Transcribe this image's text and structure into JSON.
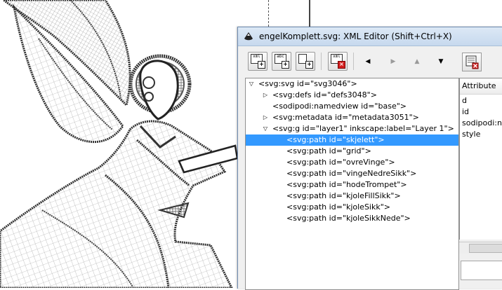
{
  "window": {
    "title": "engelKomplett.svg: XML Editor (Shift+Ctrl+X)"
  },
  "toolbar": {
    "new_element_glyph": "xml",
    "new_text_glyph": "abc",
    "delete_glyph": "xml",
    "nav_left": "◀",
    "nav_right": "▶",
    "nav_up": "▲",
    "nav_down": "▼"
  },
  "tree": {
    "rows": [
      {
        "expander": "▽",
        "text": "<svg:svg id=\"svg3046\">"
      },
      {
        "expander": "▷",
        "text": "<svg:defs id=\"defs3048\">"
      },
      {
        "expander": "",
        "text": "<sodipodi:namedview id=\"base\">"
      },
      {
        "expander": "▷",
        "text": "<svg:metadata id=\"metadata3051\">"
      },
      {
        "expander": "▽",
        "text": "<svg:g id=\"layer1\" inkscape:label=\"Layer 1\">"
      },
      {
        "expander": "",
        "text": "<svg:path id=\"skjelett\">"
      },
      {
        "expander": "",
        "text": "<svg:path id=\"grid\">"
      },
      {
        "expander": "",
        "text": "<svg:path id=\"ovreVinge\">"
      },
      {
        "expander": "",
        "text": "<svg:path id=\"vingeNedreSikk\">"
      },
      {
        "expander": "",
        "text": "<svg:path id=\"hodeTrompet\">"
      },
      {
        "expander": "",
        "text": "<svg:path id=\"kjoleFillSikk\">"
      },
      {
        "expander": "",
        "text": "<svg:path id=\"kjoleSikk\">"
      },
      {
        "expander": "",
        "text": "<svg:path id=\"kjoleSikkNede\">"
      }
    ]
  },
  "attributes": {
    "header": "Attribute",
    "rows": [
      "d",
      "id",
      "sodipodi:n",
      "style"
    ]
  }
}
